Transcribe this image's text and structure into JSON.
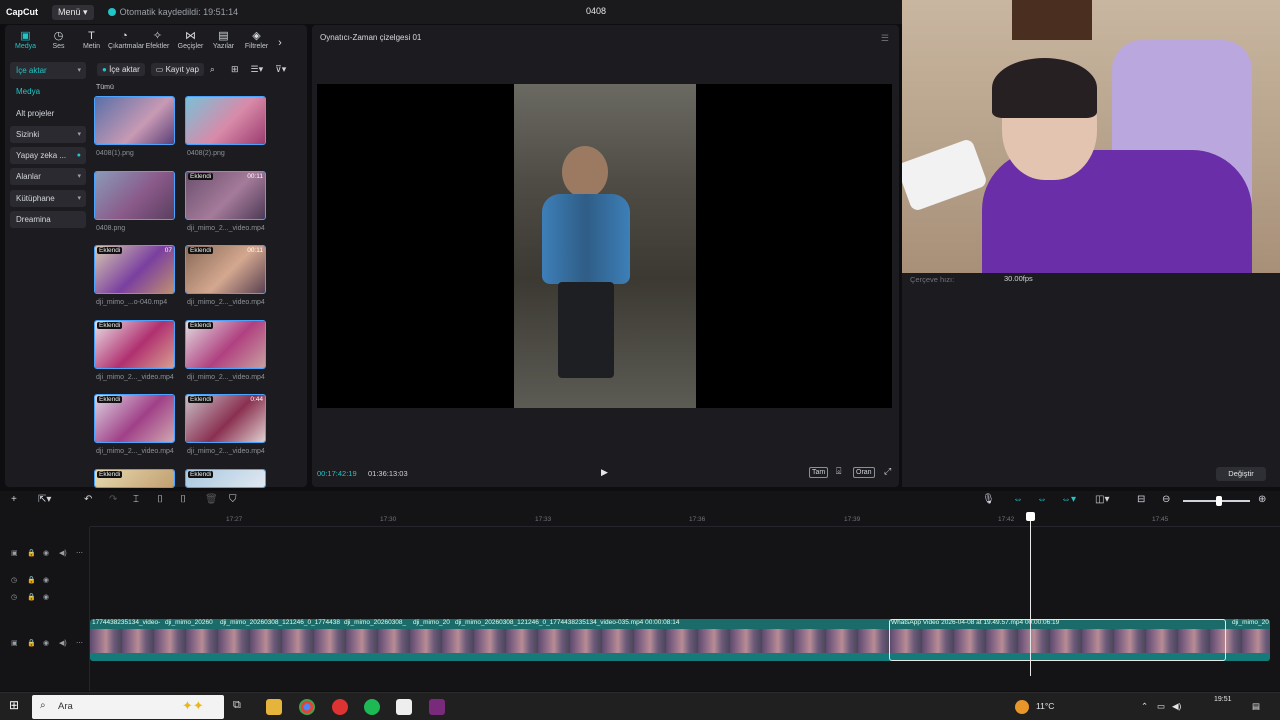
{
  "titlebar": {
    "logo": "CapCut",
    "menu_label": "Menü",
    "autosave": "Otomatik kaydedildi: 19:51:14",
    "project_title": "0408"
  },
  "left_panel": {
    "tabs": [
      {
        "label": "Medya",
        "icon": "media-icon"
      },
      {
        "label": "Ses",
        "icon": "audio-icon"
      },
      {
        "label": "Metin",
        "icon": "text-icon"
      },
      {
        "label": "Çıkartmalar",
        "icon": "sticker-icon"
      },
      {
        "label": "Efektler",
        "icon": "effects-icon"
      },
      {
        "label": "Geçişler",
        "icon": "transitions-icon"
      },
      {
        "label": "Yazılar",
        "icon": "captions-icon"
      },
      {
        "label": "Filtreler",
        "icon": "filters-icon"
      }
    ],
    "sidenav": [
      {
        "label": "İçe aktar",
        "chevron": true
      },
      {
        "label": "Medya",
        "chevron": false
      },
      {
        "label": "Alt projeler",
        "chevron": false
      },
      {
        "label": "Sizinki",
        "chevron": true
      },
      {
        "label": "Yapay zeka ...",
        "chevron": false
      },
      {
        "label": "Alanlar",
        "chevron": true
      },
      {
        "label": "Kütüphane",
        "chevron": true
      },
      {
        "label": "Dreamina",
        "chevron": false
      }
    ],
    "import_button": "İçe aktar",
    "record_button": "Kayıt yap",
    "section_label": "Tümü",
    "media": [
      {
        "name": "0408(1).png",
        "badge": "",
        "duration": ""
      },
      {
        "name": "0408(2).png",
        "badge": "",
        "duration": ""
      },
      {
        "name": "0408.png",
        "badge": "",
        "duration": ""
      },
      {
        "name": "dji_mimo_2..._video.mp4",
        "badge": "Eklendi",
        "duration": "00:11"
      },
      {
        "name": "dji_mimo_...o-040.mp4",
        "badge": "Eklendi",
        "duration": "07"
      },
      {
        "name": "dji_mimo_2..._video.mp4",
        "badge": "Eklendi",
        "duration": "00:11"
      },
      {
        "name": "dji_mimo_2..._video.mp4",
        "badge": "Eklendi",
        "duration": ""
      },
      {
        "name": "dji_mimo_2..._video.mp4",
        "badge": "Eklendi",
        "duration": ""
      },
      {
        "name": "dji_mimo_2..._video.mp4",
        "badge": "Eklendi",
        "duration": ""
      },
      {
        "name": "dji_mimo_2..._video.mp4",
        "badge": "Eklendi",
        "duration": "0:44"
      },
      {
        "name": "",
        "badge": "Eklendi",
        "duration": ""
      },
      {
        "name": "",
        "badge": "Eklendi",
        "duration": ""
      }
    ]
  },
  "player": {
    "title": "Oynatıcı-Zaman çizelgesi 01",
    "current_time": "00:17:42:19",
    "total_time": "01:36:13:03",
    "full_label": "Tam",
    "ratio_label": "Oran"
  },
  "properties": {
    "frame_rate_label": "Çerçeve hızı:",
    "frame_rate_value": "30.00fps",
    "change_button": "Değiştir"
  },
  "timeline": {
    "ruler_ticks": [
      "17:27",
      "17:30",
      "17:33",
      "17:36",
      "17:39",
      "17:42",
      "17:45"
    ],
    "clips": [
      {
        "label": "17744382351​34_video-"
      },
      {
        "label": "dji_mimo_20260"
      },
      {
        "label": "dji_mimo_20260308_121246_0_1774438"
      },
      {
        "label": "dji_mimo_20260308_"
      },
      {
        "label": "dji_mimo_20"
      },
      {
        "label": "dji_mimo_20260308_121246_0_1774438235134_video-035.mp4   00:00:08:14"
      },
      {
        "label": "WhatsApp Video 2026-04-08 at 19.49.57.mp4   00:00:06:19"
      },
      {
        "label": "dji_mimo_20"
      }
    ]
  },
  "taskbar": {
    "search_placeholder": "Ara",
    "temperature": "11°C",
    "time": "19:51"
  },
  "colors": {
    "accent": "#20c5c7",
    "panel": "#1c1c20",
    "background": "#0e0e10"
  }
}
